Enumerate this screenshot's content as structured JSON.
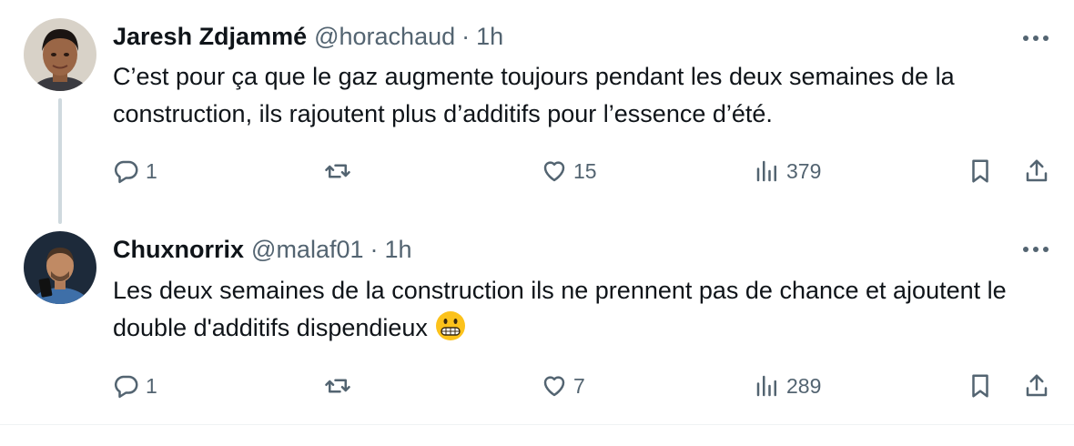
{
  "tweets": [
    {
      "name": "Jaresh Zdjammé",
      "handle": "@horachaud",
      "separator": "·",
      "time": "1h",
      "text": "C’est pour ça que le gaz augmente toujours pendant les deux semaines de la construction, ils rajoutent plus d’additifs pour l’essence d’été.",
      "replies": "1",
      "retweets": "",
      "likes": "15",
      "views": "379"
    },
    {
      "name": "Chuxnorrix",
      "handle": "@malaf01",
      "separator": "·",
      "time": "1h",
      "text": "Les deux semaines de la construction ils ne prennent pas de chance et ajoutent le double d'additifs dispendieux",
      "emoji": "grimacing-face",
      "replies": "1",
      "retweets": "",
      "likes": "7",
      "views": "289"
    }
  ],
  "colors": {
    "text": "#0f1419",
    "secondary": "#536471",
    "thread_line": "#cfd9de",
    "divider": "#eff3f4"
  },
  "icons": [
    "more-icon",
    "reply-icon",
    "retweet-icon",
    "like-icon",
    "views-icon",
    "bookmark-icon",
    "share-icon"
  ]
}
